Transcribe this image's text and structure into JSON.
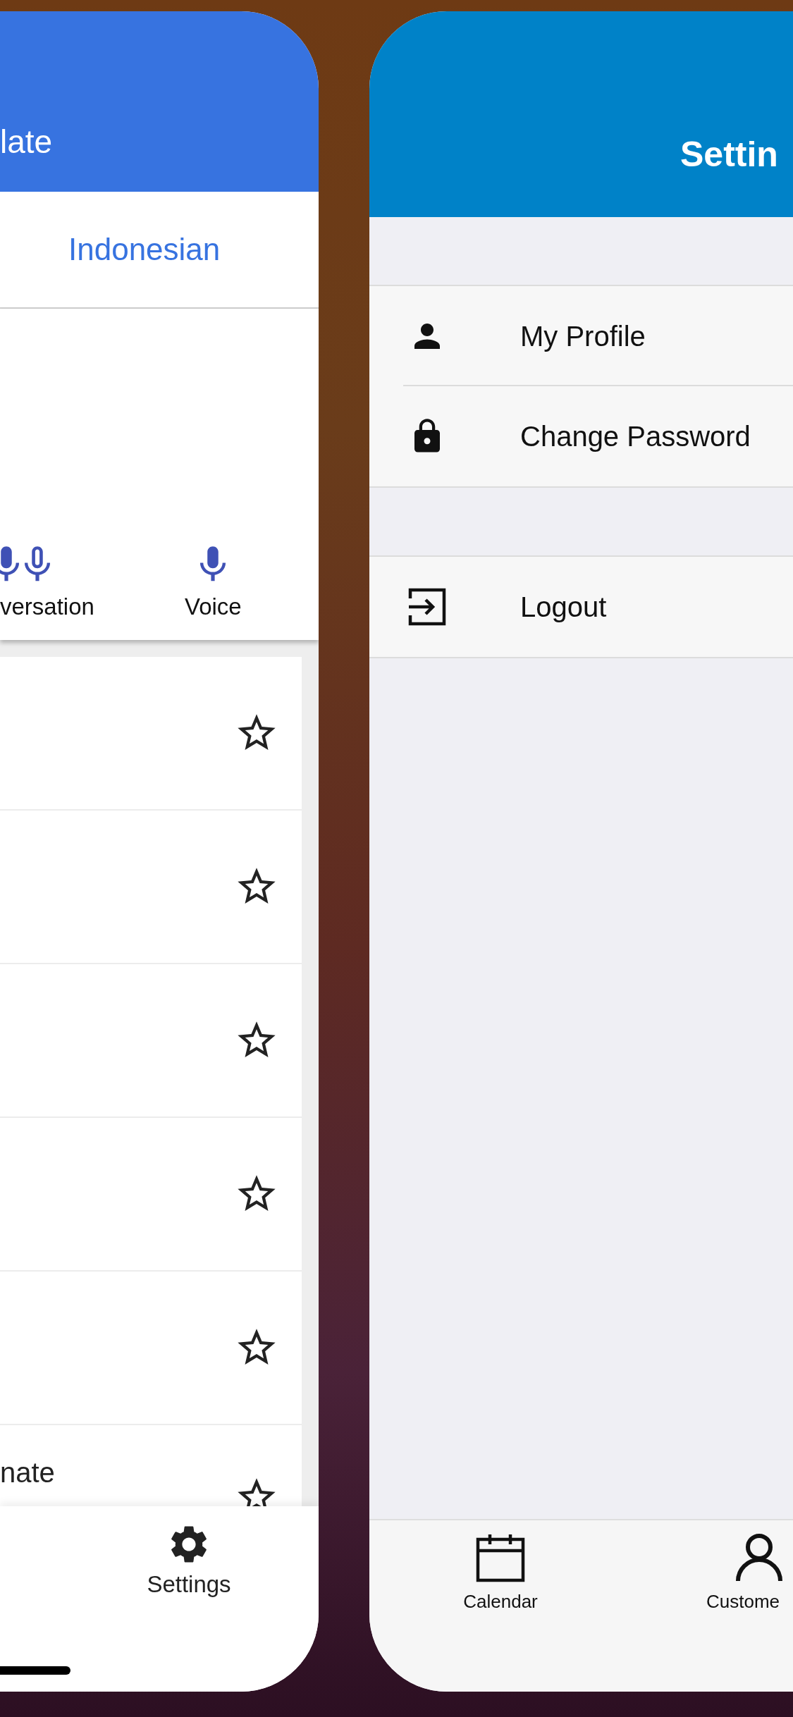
{
  "translate_app": {
    "header": {
      "title": "late"
    },
    "language_bar": {
      "target": "Indonesian"
    },
    "input_modes": [
      {
        "kind": "conversation",
        "label": "versation"
      },
      {
        "kind": "voice",
        "label": "Voice"
      }
    ],
    "phrases": [
      {
        "starred": false
      },
      {
        "starred": false
      },
      {
        "starred": false
      },
      {
        "starred": false
      },
      {
        "starred": false
      },
      {
        "text": "nate",
        "starred": false
      }
    ],
    "bottom_nav": [
      {
        "label": "Settings"
      }
    ]
  },
  "settings_app": {
    "header": {
      "title": "Settin"
    },
    "sections": [
      [
        {
          "label": "My Profile"
        },
        {
          "label": "Change Password"
        }
      ],
      [
        {
          "label": "Logout"
        }
      ]
    ],
    "bottom_nav": [
      {
        "label": "Calendar"
      },
      {
        "label": "Custome"
      }
    ]
  }
}
